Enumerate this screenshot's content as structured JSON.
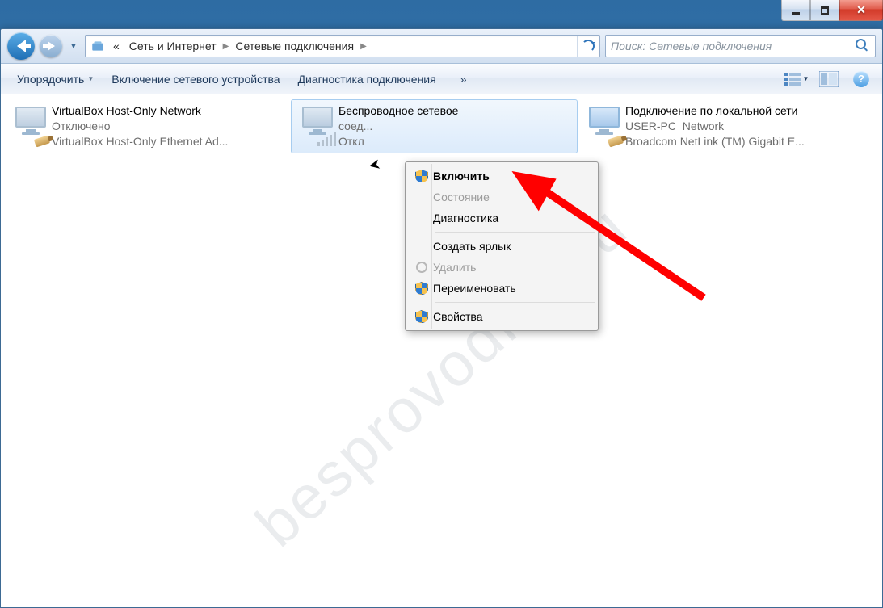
{
  "windowControls": {
    "minimize": "minimize",
    "maximize": "maximize",
    "close": "close"
  },
  "address": {
    "prefix": "«",
    "seg1": "Сеть и Интернет",
    "seg2": "Сетевые подключения"
  },
  "search": {
    "placeholder": "Поиск: Сетевые подключения"
  },
  "toolbar": {
    "organize": "Упорядочить",
    "enableDevice": "Включение сетевого устройства",
    "diagnose": "Диагностика подключения",
    "overflow": "»"
  },
  "connections": [
    {
      "name": "VirtualBox Host-Only Network",
      "status": "Отключено",
      "device": "VirtualBox Host-Only Ethernet Ad...",
      "iconType": "lan",
      "selected": false
    },
    {
      "name": "Беспроводное сетевое соед...",
      "nameShort": "Беспроводное сетевое",
      "statusShort": "соед...",
      "status": "Откл",
      "device": "",
      "iconType": "wifi",
      "selected": true
    },
    {
      "name": "Подключение по локальной сети",
      "status": "USER-PC_Network",
      "device": "Broadcom NetLink (TM) Gigabit E...",
      "iconType": "lan",
      "selected": false
    }
  ],
  "contextMenu": {
    "items": [
      {
        "label": "Включить",
        "shield": true,
        "enabled": true,
        "bold": true
      },
      {
        "label": "Состояние",
        "shield": false,
        "enabled": false,
        "bold": false
      },
      {
        "label": "Диагностика",
        "shield": false,
        "enabled": true,
        "bold": false
      },
      {
        "sep": true
      },
      {
        "label": "Создать ярлык",
        "shield": false,
        "enabled": true,
        "bold": false
      },
      {
        "label": "Удалить",
        "shield": true,
        "enabled": false,
        "bold": false,
        "radioicon": false
      },
      {
        "label": "Переименовать",
        "shield": true,
        "enabled": true,
        "bold": false
      },
      {
        "sep": true
      },
      {
        "label": "Свойства",
        "shield": true,
        "enabled": true,
        "bold": false
      }
    ]
  },
  "watermark": "besprovodnik.ru"
}
